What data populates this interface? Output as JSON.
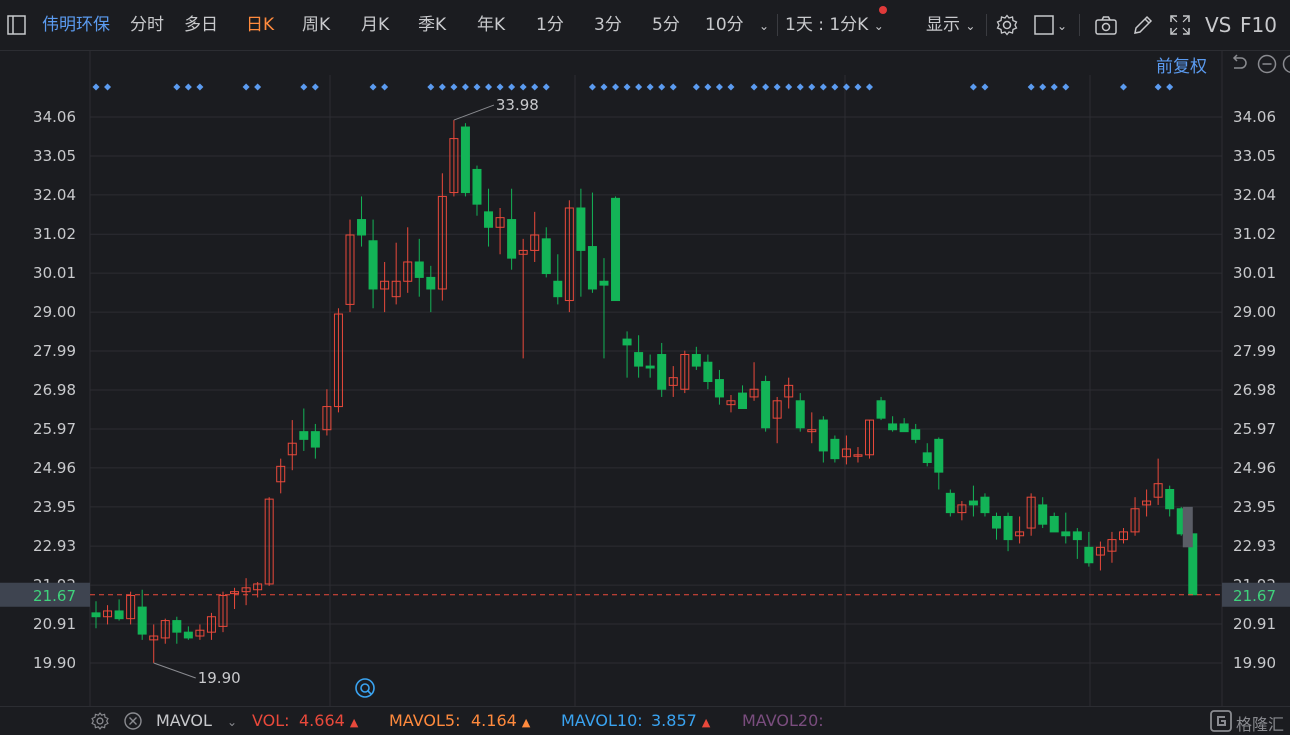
{
  "toolbar": {
    "stock_name": "伟明环保",
    "periods": [
      "分时",
      "多日",
      "日K",
      "周K",
      "月K",
      "季K",
      "年K",
      "1分",
      "3分",
      "5分",
      "10分"
    ],
    "active_period": "日K",
    "interval_label": "1天 : 1分K",
    "display_label": "显示",
    "vs_label": "VS",
    "f10_label": "F10"
  },
  "adjust_label": "前复权",
  "colors": {
    "background": "#1b1c20",
    "up": "#e9493b",
    "down": "#13b457",
    "grid": "#2c2d32",
    "axis_text": "#c8c9cc",
    "accent_blue": "#5b9bf0",
    "active_orange": "#ff8a3d",
    "current_price_bg": "#3e4450",
    "current_price_text": "#3fd27c"
  },
  "chart_data": {
    "type": "candlestick",
    "y_ticks": [
      "34.06",
      "33.05",
      "32.04",
      "31.02",
      "30.01",
      "29.00",
      "27.99",
      "26.98",
      "25.97",
      "24.96",
      "23.95",
      "22.93",
      "21.92",
      "20.91",
      "19.90"
    ],
    "ylim": [
      19.5,
      35.0
    ],
    "current_price": "21.67",
    "max_label": "33.98",
    "min_label": "19.90",
    "candles": [
      {
        "o": 21.2,
        "h": 21.5,
        "l": 20.8,
        "c": 21.1
      },
      {
        "o": 21.1,
        "h": 21.4,
        "l": 20.9,
        "c": 21.25
      },
      {
        "o": 21.25,
        "h": 21.55,
        "l": 21.0,
        "c": 21.05
      },
      {
        "o": 21.05,
        "h": 21.75,
        "l": 20.9,
        "c": 21.65
      },
      {
        "o": 21.35,
        "h": 21.8,
        "l": 20.5,
        "c": 20.65
      },
      {
        "o": 20.5,
        "h": 20.9,
        "l": 19.9,
        "c": 20.6
      },
      {
        "o": 20.55,
        "h": 21.05,
        "l": 20.4,
        "c": 21.0
      },
      {
        "o": 21.0,
        "h": 21.1,
        "l": 20.4,
        "c": 20.7
      },
      {
        "o": 20.7,
        "h": 20.85,
        "l": 20.5,
        "c": 20.55
      },
      {
        "o": 20.6,
        "h": 20.9,
        "l": 20.5,
        "c": 20.75
      },
      {
        "o": 20.7,
        "h": 21.2,
        "l": 20.5,
        "c": 21.1
      },
      {
        "o": 20.85,
        "h": 21.75,
        "l": 20.7,
        "c": 21.65
      },
      {
        "o": 21.7,
        "h": 21.85,
        "l": 21.3,
        "c": 21.75
      },
      {
        "o": 21.75,
        "h": 22.1,
        "l": 21.4,
        "c": 21.85
      },
      {
        "o": 21.8,
        "h": 22.0,
        "l": 21.6,
        "c": 21.95
      },
      {
        "o": 21.95,
        "h": 24.2,
        "l": 21.9,
        "c": 24.15
      },
      {
        "o": 24.6,
        "h": 25.2,
        "l": 24.3,
        "c": 25.0
      },
      {
        "o": 25.3,
        "h": 26.2,
        "l": 24.9,
        "c": 25.6
      },
      {
        "o": 25.9,
        "h": 26.5,
        "l": 25.4,
        "c": 25.7
      },
      {
        "o": 25.9,
        "h": 26.1,
        "l": 25.2,
        "c": 25.5
      },
      {
        "o": 25.95,
        "h": 27.0,
        "l": 25.8,
        "c": 26.55
      },
      {
        "o": 26.55,
        "h": 29.1,
        "l": 26.4,
        "c": 28.95
      },
      {
        "o": 29.2,
        "h": 31.4,
        "l": 29.0,
        "c": 31.0
      },
      {
        "o": 31.4,
        "h": 32.0,
        "l": 30.7,
        "c": 31.0
      },
      {
        "o": 30.85,
        "h": 31.4,
        "l": 29.1,
        "c": 29.6
      },
      {
        "o": 29.6,
        "h": 30.3,
        "l": 29.0,
        "c": 29.8
      },
      {
        "o": 29.4,
        "h": 30.8,
        "l": 29.2,
        "c": 29.8
      },
      {
        "o": 29.8,
        "h": 31.2,
        "l": 29.5,
        "c": 30.3
      },
      {
        "o": 30.3,
        "h": 30.9,
        "l": 29.4,
        "c": 29.9
      },
      {
        "o": 29.9,
        "h": 30.2,
        "l": 29.0,
        "c": 29.6
      },
      {
        "o": 29.6,
        "h": 32.6,
        "l": 29.3,
        "c": 32.0
      },
      {
        "o": 32.1,
        "h": 33.98,
        "l": 32.0,
        "c": 33.5
      },
      {
        "o": 33.8,
        "h": 33.9,
        "l": 32.0,
        "c": 32.1
      },
      {
        "o": 32.7,
        "h": 32.8,
        "l": 31.5,
        "c": 31.8
      },
      {
        "o": 31.6,
        "h": 32.2,
        "l": 30.7,
        "c": 31.2
      },
      {
        "o": 31.2,
        "h": 31.7,
        "l": 30.5,
        "c": 31.45
      },
      {
        "o": 31.4,
        "h": 32.2,
        "l": 30.1,
        "c": 30.4
      },
      {
        "o": 30.5,
        "h": 30.9,
        "l": 27.8,
        "c": 30.6
      },
      {
        "o": 30.6,
        "h": 31.6,
        "l": 30.3,
        "c": 31.0
      },
      {
        "o": 30.9,
        "h": 31.2,
        "l": 29.9,
        "c": 30.0
      },
      {
        "o": 29.8,
        "h": 30.5,
        "l": 29.2,
        "c": 29.4
      },
      {
        "o": 29.3,
        "h": 31.9,
        "l": 29.0,
        "c": 31.7
      },
      {
        "o": 31.7,
        "h": 32.2,
        "l": 29.4,
        "c": 30.6
      },
      {
        "o": 30.7,
        "h": 32.1,
        "l": 29.5,
        "c": 29.6
      },
      {
        "o": 29.8,
        "h": 30.4,
        "l": 27.8,
        "c": 29.7
      },
      {
        "o": 31.95,
        "h": 32.0,
        "l": 29.3,
        "c": 29.3
      },
      {
        "o": 28.3,
        "h": 28.5,
        "l": 27.3,
        "c": 28.15
      },
      {
        "o": 27.95,
        "h": 28.4,
        "l": 27.3,
        "c": 27.6
      },
      {
        "o": 27.6,
        "h": 27.9,
        "l": 27.3,
        "c": 27.55
      },
      {
        "o": 27.9,
        "h": 28.2,
        "l": 26.8,
        "c": 27.0
      },
      {
        "o": 27.1,
        "h": 27.6,
        "l": 26.8,
        "c": 27.3
      },
      {
        "o": 27.0,
        "h": 28.0,
        "l": 26.9,
        "c": 27.9
      },
      {
        "o": 27.9,
        "h": 28.1,
        "l": 27.5,
        "c": 27.6
      },
      {
        "o": 27.7,
        "h": 27.9,
        "l": 27.0,
        "c": 27.2
      },
      {
        "o": 27.25,
        "h": 27.5,
        "l": 26.6,
        "c": 26.8
      },
      {
        "o": 26.6,
        "h": 26.85,
        "l": 26.4,
        "c": 26.7
      },
      {
        "o": 26.9,
        "h": 27.1,
        "l": 26.5,
        "c": 26.5
      },
      {
        "o": 26.8,
        "h": 27.7,
        "l": 26.7,
        "c": 27.0
      },
      {
        "o": 27.2,
        "h": 27.35,
        "l": 25.9,
        "c": 26.0
      },
      {
        "o": 26.25,
        "h": 26.8,
        "l": 25.6,
        "c": 26.7
      },
      {
        "o": 26.8,
        "h": 27.3,
        "l": 26.5,
        "c": 27.1
      },
      {
        "o": 26.7,
        "h": 26.9,
        "l": 25.9,
        "c": 26.0
      },
      {
        "o": 25.9,
        "h": 26.4,
        "l": 25.6,
        "c": 25.95
      },
      {
        "o": 26.2,
        "h": 26.3,
        "l": 25.1,
        "c": 25.4
      },
      {
        "o": 25.7,
        "h": 25.8,
        "l": 25.1,
        "c": 25.2
      },
      {
        "o": 25.25,
        "h": 25.8,
        "l": 25.05,
        "c": 25.45
      },
      {
        "o": 25.3,
        "h": 25.5,
        "l": 25.1,
        "c": 25.3
      },
      {
        "o": 25.3,
        "h": 26.2,
        "l": 25.2,
        "c": 26.2
      },
      {
        "o": 26.7,
        "h": 26.8,
        "l": 26.2,
        "c": 26.25
      },
      {
        "o": 26.1,
        "h": 26.3,
        "l": 25.9,
        "c": 25.95
      },
      {
        "o": 26.1,
        "h": 26.25,
        "l": 25.9,
        "c": 25.9
      },
      {
        "o": 25.95,
        "h": 26.1,
        "l": 25.6,
        "c": 25.7
      },
      {
        "o": 25.35,
        "h": 25.6,
        "l": 25.0,
        "c": 25.1
      },
      {
        "o": 25.7,
        "h": 25.75,
        "l": 24.4,
        "c": 24.85
      },
      {
        "o": 24.3,
        "h": 24.4,
        "l": 23.7,
        "c": 23.8
      },
      {
        "o": 23.8,
        "h": 24.1,
        "l": 23.6,
        "c": 24.0
      },
      {
        "o": 24.1,
        "h": 24.5,
        "l": 23.7,
        "c": 24.0
      },
      {
        "o": 24.2,
        "h": 24.3,
        "l": 23.7,
        "c": 23.8
      },
      {
        "o": 23.7,
        "h": 23.8,
        "l": 23.1,
        "c": 23.4
      },
      {
        "o": 23.7,
        "h": 23.8,
        "l": 22.8,
        "c": 23.1
      },
      {
        "o": 23.2,
        "h": 23.7,
        "l": 23.0,
        "c": 23.3
      },
      {
        "o": 23.4,
        "h": 24.3,
        "l": 23.2,
        "c": 24.2
      },
      {
        "o": 24.0,
        "h": 24.2,
        "l": 23.4,
        "c": 23.5
      },
      {
        "o": 23.7,
        "h": 23.8,
        "l": 23.3,
        "c": 23.3
      },
      {
        "o": 23.3,
        "h": 23.8,
        "l": 23.0,
        "c": 23.2
      },
      {
        "o": 23.3,
        "h": 23.4,
        "l": 22.6,
        "c": 23.1
      },
      {
        "o": 22.9,
        "h": 23.3,
        "l": 22.4,
        "c": 22.5
      },
      {
        "o": 22.7,
        "h": 23.05,
        "l": 22.3,
        "c": 22.9
      },
      {
        "o": 22.8,
        "h": 23.3,
        "l": 22.5,
        "c": 23.1
      },
      {
        "o": 23.1,
        "h": 23.4,
        "l": 23.0,
        "c": 23.3
      },
      {
        "o": 23.3,
        "h": 24.2,
        "l": 23.2,
        "c": 23.9
      },
      {
        "o": 24.0,
        "h": 24.4,
        "l": 23.7,
        "c": 24.1
      },
      {
        "o": 24.2,
        "h": 25.2,
        "l": 24.0,
        "c": 24.55
      },
      {
        "o": 24.4,
        "h": 24.5,
        "l": 23.7,
        "c": 23.9
      },
      {
        "o": 23.9,
        "h": 23.95,
        "l": 23.2,
        "c": 23.25
      },
      {
        "o": 23.25,
        "h": 23.25,
        "l": 21.67,
        "c": 21.67
      }
    ],
    "signal_groups": [
      [
        0,
        1
      ],
      [
        7,
        8,
        9
      ],
      [
        13,
        14
      ],
      [
        18,
        19
      ],
      [
        24,
        25
      ],
      [
        29,
        30,
        31,
        32,
        33,
        34,
        35,
        36,
        37,
        38,
        39
      ],
      [
        43,
        44,
        45,
        46,
        47,
        48,
        49,
        50
      ],
      [
        52,
        53,
        54,
        55
      ],
      [
        57,
        58,
        59,
        60,
        61,
        62,
        63,
        64,
        65,
        66,
        67
      ],
      [
        76,
        77
      ],
      [
        81,
        82,
        83,
        84
      ],
      [
        89
      ],
      [
        92,
        93
      ]
    ]
  },
  "indicator": {
    "name": "MAVOL",
    "vol_label": "VOL:",
    "vol_value": "4.664",
    "mavol5_label": "MAVOL5:",
    "mavol5_value": "4.164",
    "mavol10_label": "MAVOL10:",
    "mavol10_value": "3.857",
    "mavol20_label": "MAVOL20:"
  },
  "watermark": "格隆汇",
  "icons": {
    "sidebar_toggle": "sidebar-toggle-icon",
    "settings": "gear-icon",
    "square": "square-icon",
    "camera": "camera-icon",
    "pencil": "pencil-icon",
    "expand": "expand-icon",
    "undo": "undo-icon",
    "minus": "minus-circle-icon",
    "plus": "plus-circle-icon",
    "search": "search-marker-icon",
    "close": "close-icon"
  }
}
